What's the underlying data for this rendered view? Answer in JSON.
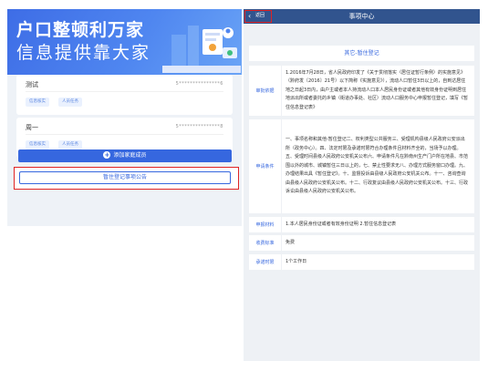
{
  "left_panel": {
    "banner": {
      "line1": "户口整顿利万家",
      "line2": "信息提供靠大家"
    },
    "members": [
      {
        "name": "测试",
        "id_masked": "5***************6",
        "tag_edit": "信息核实",
        "tag_count": "人员任务"
      },
      {
        "name": "周一",
        "id_masked": "5***************8",
        "tag_edit": "信息核实",
        "tag_count": "人员任务"
      }
    ],
    "add_member_label": "添加家庭成员",
    "notice_button_label": "暂住登记事项公告"
  },
  "right_panel": {
    "nav": {
      "back_label": "返回",
      "title": "事项中心"
    },
    "item_title": "其它-暂住登记",
    "rows": [
      {
        "key": "审批依据",
        "value": "1.2016年7月28日，省人民政府印发了《关于贯彻落实〈居住证暂行条例〉的实施意见》（黔府发〔2016〕21号）以下简称《实施意见》），流动人口暂住3日以上的，自到达居住地之日起3日内，由户主或者本人持流动人口本人居民身份证或者其他有效身份证明到居住地派出所或者委托的乡镇（街道办事处、社区）流动人口服务中心申报暂住登记，填写《暂住信息登记表》"
      },
      {
        "key": "申请条件",
        "value": "一、事项名称和其他-暂住登记二、权利类型公共服务三、受理机构县级人民政府公安派出所（政务中心）。四、法定时限及承诺时限符合办理条件且材料齐全的，当场予以办理。五、受理时间县级人民政府公安机关公布六、申请条件凡在黔南州生产门户所在地县、市范围以外的城市、城镇暂住三日以上的，七、禁止性要求无八、办理方式服务窗口办理。九、办理结果出具《暂住登记》。十、监督投诉由县级人民政府公安机关公布。十一、咨询查询由县级人民政府公安机关公布。十二、行政复议由县级人民政府公安机关公布。十三、行政诉讼由县级人民政府公安机关公布。"
      },
      {
        "key": "申报材料",
        "value": "1.本人居民身份证或者有效身份证明 2.暂住信息登记表"
      },
      {
        "key": "收费标准",
        "value": "免费"
      },
      {
        "key": "承诺时限",
        "value": "1个工作日"
      }
    ]
  },
  "colors": {
    "primary": "#3667df",
    "nav": "#31548e",
    "highlight": "#e02424",
    "background": "#eef1f5"
  }
}
